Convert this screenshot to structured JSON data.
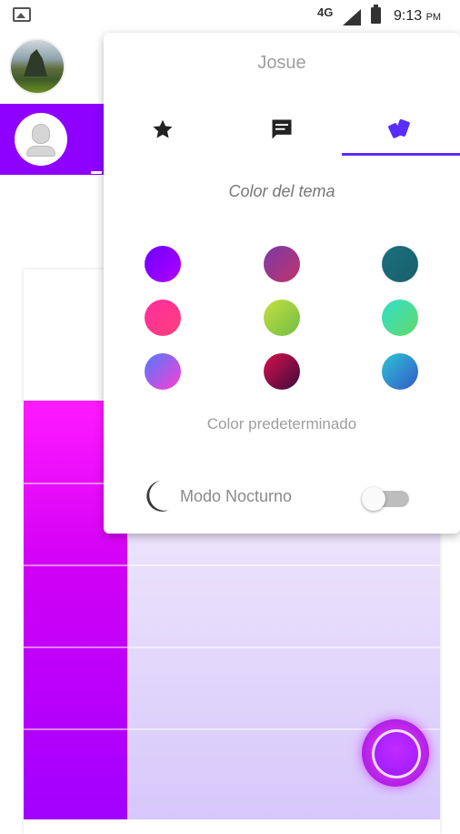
{
  "status_bar": {
    "network": "4G",
    "time": "9:13",
    "ampm": "PM"
  },
  "popup": {
    "title": "Josue",
    "tabs": [
      {
        "icon": "star-icon",
        "selected": false
      },
      {
        "icon": "chat-bubble-icon",
        "selected": false
      },
      {
        "icon": "palette-cards-icon",
        "selected": true
      }
    ],
    "section_label": "Color del tema",
    "swatches": [
      {
        "name": "purple-violet",
        "from": "#6a00ff",
        "to": "#b300ff"
      },
      {
        "name": "crimson-purple",
        "from": "#7b3aa8",
        "to": "#c0336a"
      },
      {
        "name": "dark-teal",
        "from": "#1b6f7e",
        "to": "#1a5f6c"
      },
      {
        "name": "pink-red",
        "from": "#ff2ea0",
        "to": "#ff3f7a"
      },
      {
        "name": "lime-green",
        "from": "#c6e040",
        "to": "#6fbd45"
      },
      {
        "name": "cyan-green",
        "from": "#2fe0c8",
        "to": "#65d86a"
      },
      {
        "name": "blue-magenta",
        "from": "#4e7bff",
        "to": "#ff3cd2"
      },
      {
        "name": "wine-dark",
        "from": "#d8104f",
        "to": "#3c0b3a"
      },
      {
        "name": "ocean-blue",
        "from": "#2ec5d5",
        "to": "#3457c8"
      }
    ],
    "default_color_label": "Color predeterminado",
    "night_mode_label": "Modo Nocturno",
    "night_mode_on": false
  },
  "colors": {
    "accent": "#5a2dff",
    "drawer_purple": "#8e00ff",
    "fab": "#a100ff"
  }
}
